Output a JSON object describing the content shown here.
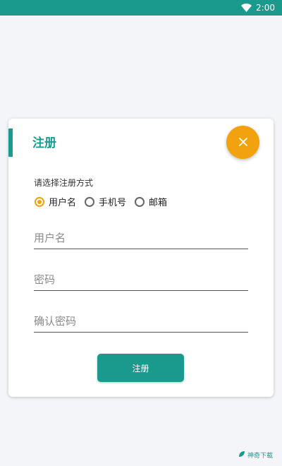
{
  "status_bar": {
    "time": "2:00",
    "wifi_icon": "wifi-icon"
  },
  "dialog": {
    "title": "注册",
    "close_icon": "close-icon",
    "method_prompt": "请选择注册方式",
    "methods": [
      {
        "label": "用户名",
        "checked": true
      },
      {
        "label": "手机号",
        "checked": false
      },
      {
        "label": "邮箱",
        "checked": false
      }
    ],
    "fields": {
      "username_placeholder": "用户名",
      "username_value": "",
      "password_placeholder": "密码",
      "password_value": "",
      "confirm_password_placeholder": "确认密码",
      "confirm_password_value": ""
    },
    "submit_label": "注册"
  },
  "watermark": {
    "text": "神奇下载"
  },
  "colors": {
    "primary": "#1a9a8c",
    "accent": "#f2a20e",
    "background": "#f4f5f9"
  }
}
